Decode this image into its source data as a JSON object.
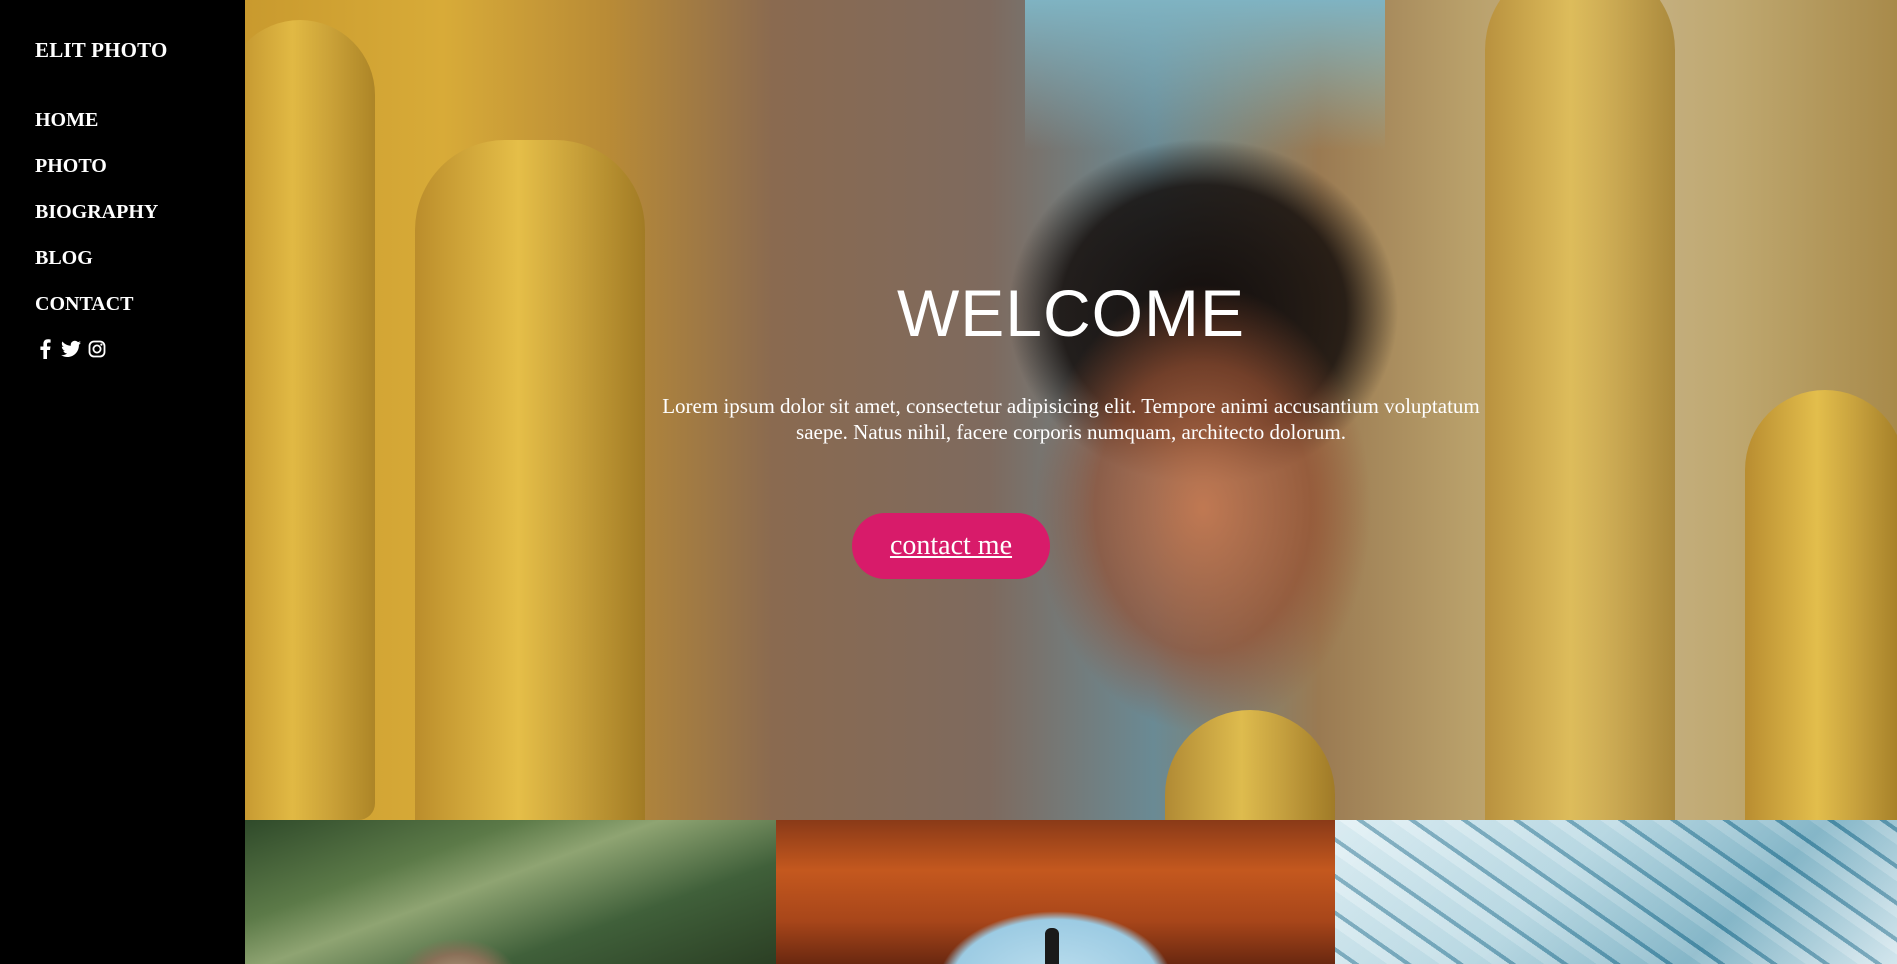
{
  "sidebar": {
    "brand": "ELIT PHOTO",
    "nav": [
      {
        "label": "HOME"
      },
      {
        "label": "PHOTO"
      },
      {
        "label": "BIOGRAPHY"
      },
      {
        "label": "BLOG"
      },
      {
        "label": "CONTACT"
      }
    ],
    "socials": [
      {
        "icon": "facebook-icon"
      },
      {
        "icon": "twitter-icon"
      },
      {
        "icon": "instagram-icon"
      }
    ]
  },
  "hero": {
    "title": "WELCOME",
    "text": "Lorem ipsum dolor sit amet, consectetur adipisicing elit. Tempore animi accusantium voluptatum saepe. Natus nihil, facere corporis numquam, architecto dolorum.",
    "button_label": "contact me"
  },
  "colors": {
    "sidebar_bg": "#000000",
    "button_bg": "#d81b6a",
    "text": "#ffffff"
  }
}
